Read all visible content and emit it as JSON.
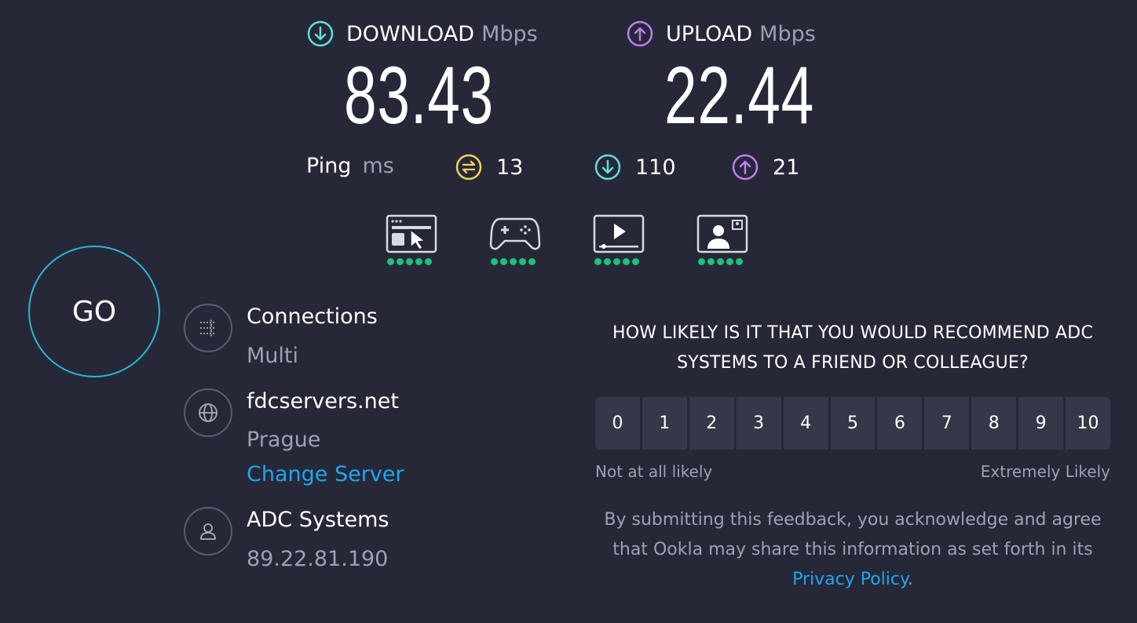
{
  "download": {
    "label": "DOWNLOAD",
    "unit": "Mbps",
    "value": "83.43",
    "color": "#5fe0d8"
  },
  "upload": {
    "label": "UPLOAD",
    "unit": "Mbps",
    "value": "22.44",
    "color": "#c17cf2"
  },
  "ping": {
    "label": "Ping",
    "unit": "ms",
    "idle": "13",
    "download": "110",
    "upload": "21",
    "idle_color": "#f3d35a"
  },
  "quality_icons": [
    {
      "icon": "web-browsing-icon",
      "rating": 5
    },
    {
      "icon": "gaming-icon",
      "rating": 5
    },
    {
      "icon": "video-streaming-icon",
      "rating": 5
    },
    {
      "icon": "video-chat-icon",
      "rating": 5
    }
  ],
  "go_button": {
    "label": "GO"
  },
  "connections": {
    "title": "Connections",
    "value": "Multi"
  },
  "server": {
    "host": "fdcservers.net",
    "location": "Prague",
    "change_link": "Change Server"
  },
  "provider": {
    "name": "ADC Systems",
    "ip": "89.22.81.190"
  },
  "survey": {
    "question": "HOW LIKELY IS IT THAT YOU WOULD RECOMMEND ADC SYSTEMS TO A FRIEND OR COLLEAGUE?",
    "scale": [
      "0",
      "1",
      "2",
      "3",
      "4",
      "5",
      "6",
      "7",
      "8",
      "9",
      "10"
    ],
    "low_label": "Not at all likely",
    "high_label": "Extremely Likely",
    "disclaimer_prefix": "By submitting this feedback, you acknowledge and agree that Ookla may share this information as set forth in its ",
    "privacy_link": "Privacy Policy",
    "disclaimer_suffix": "."
  },
  "colors": {
    "background": "#262838",
    "accent": "#1da7f0",
    "good": "#1fc17a"
  }
}
